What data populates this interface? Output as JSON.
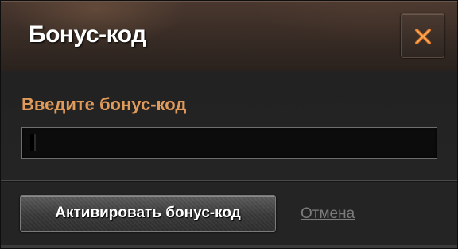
{
  "dialog": {
    "title": "Бонус-код",
    "close_icon": "close-x-icon",
    "accent_color": "#e09a5a",
    "prompt_label": "Введите бонус-код",
    "input_value": "",
    "activate_label": "Активировать бонус-код",
    "cancel_label": "Отмена"
  }
}
